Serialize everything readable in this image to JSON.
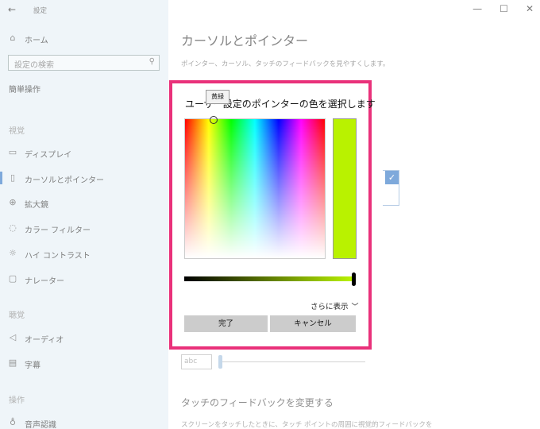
{
  "window": {
    "app_name": "設定",
    "back": "←",
    "minimize": "—",
    "maximize": "☐",
    "close": "✕"
  },
  "sidebar": {
    "home_label": "ホーム",
    "search_placeholder": "設定の検索",
    "category": "簡単操作",
    "sections": [
      {
        "title": "視覚",
        "items": [
          "ディスプレイ",
          "カーソルとポインター",
          "拡大鏡",
          "カラー フィルター",
          "ハイ コントラスト",
          "ナレーター"
        ]
      },
      {
        "title": "聴覚",
        "items": [
          "オーディオ",
          "字幕"
        ]
      },
      {
        "title": "操作",
        "items": [
          "音声認識"
        ]
      }
    ],
    "active_item": "カーソルとポインター"
  },
  "main": {
    "title": "カーソルとポインター",
    "description": "ポインター、カーソル、タッチのフィードバックを見やすくします。",
    "abc_sample": "abc",
    "touch_heading": "タッチのフィードバックを変更する",
    "touch_description": "スクリーンをタッチしたときに、タッチ ポイントの周囲に視覚的フィードバックを"
  },
  "dialog": {
    "title": "ユーザー設定のポインターの色を選択します",
    "tooltip": "黄緑",
    "selected_color": "#b9f200",
    "more_label": "さらに表示",
    "done_label": "完了",
    "cancel_label": "キャンセル",
    "frame_color": "#e9317a",
    "brightness_level": 1.0
  },
  "icons": {
    "home": "home-icon",
    "search": "search-icon",
    "display": "display-icon",
    "cursor": "cursor-icon",
    "magnifier": "magnifier-icon",
    "color_filter": "color-filter-icon",
    "high_contrast": "high-contrast-icon",
    "narrator": "narrator-icon",
    "audio": "audio-icon",
    "captions": "captions-icon",
    "speech": "microphone-icon"
  }
}
